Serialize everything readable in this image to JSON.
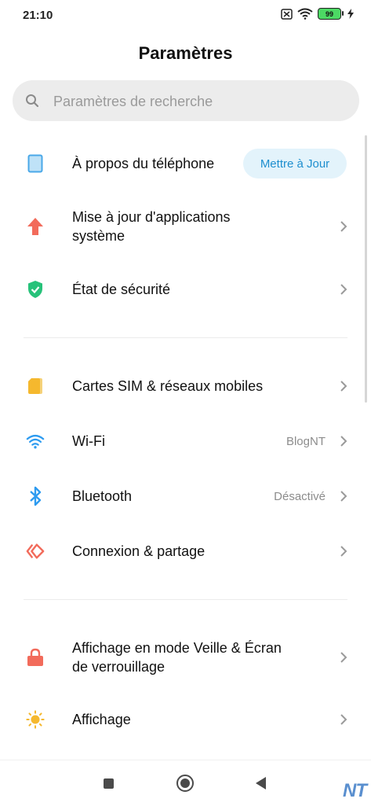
{
  "status_bar": {
    "time": "21:10",
    "battery_level": "99",
    "icons": [
      "no-sim-icon",
      "wifi-icon",
      "battery-icon",
      "charging-icon"
    ]
  },
  "header": {
    "title": "Paramètres"
  },
  "search": {
    "placeholder": "Paramètres de recherche"
  },
  "sections": {
    "about": {
      "label": "À propos du téléphone",
      "button": "Mettre à Jour",
      "icon": "phone-icon"
    },
    "app_update": {
      "label_line1": "Mise à jour d'applications",
      "label_line2": "système",
      "icon": "arrow-up-icon"
    },
    "security": {
      "label": "État de sécurité",
      "icon": "shield-check-icon"
    },
    "sim": {
      "label": "Cartes SIM & réseaux mobiles",
      "icon": "sim-card-icon"
    },
    "wifi": {
      "label": "Wi-Fi",
      "value": "BlogNT",
      "icon": "wifi-icon"
    },
    "bluetooth": {
      "label": "Bluetooth",
      "value": "Désactivé",
      "icon": "bluetooth-icon"
    },
    "connection": {
      "label": "Connexion & partage",
      "icon": "share-icon"
    },
    "lockscreen": {
      "label_line1": "Affichage en mode Veille & Écran",
      "label_line2": "de verrouillage",
      "icon": "lock-icon"
    },
    "display": {
      "label": "Affichage",
      "icon": "sun-icon"
    }
  },
  "nav_bar": {
    "icons": [
      "recents-icon",
      "home-icon",
      "back-icon"
    ]
  },
  "watermark": "NT",
  "colors": {
    "accent": "#1e8fcf",
    "pill_background": "#e3f3fb",
    "search_background": "#ececec",
    "phone_icon": "#4aa8e8",
    "arrow_icon": "#f26b5b",
    "shield_icon": "#27c27a",
    "sim_icon": "#f5b82e",
    "wifi_icon": "#2d9bf0",
    "bluetooth_icon": "#2d9bf0",
    "share_icon": "#f26b5b",
    "lock_icon": "#f26b5b",
    "sun_icon": "#f5b82e"
  }
}
